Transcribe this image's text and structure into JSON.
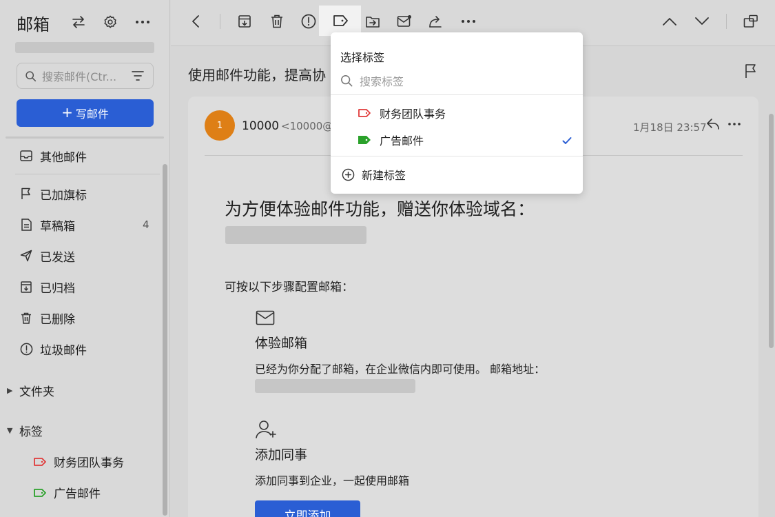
{
  "sidebar": {
    "title": "邮箱",
    "search_placeholder": "搜索邮件(Ctr...",
    "compose_label": "写邮件",
    "items": [
      {
        "label": "其他邮件"
      },
      {
        "label": "已加旗标"
      },
      {
        "label": "草稿箱",
        "count": "4"
      },
      {
        "label": "已发送"
      },
      {
        "label": "已归档"
      },
      {
        "label": "已删除"
      },
      {
        "label": "垃圾邮件"
      }
    ],
    "folders_label": "文件夹",
    "tags_label": "标签",
    "tags": [
      {
        "label": "财务团队事务",
        "color": "#e03a3a"
      },
      {
        "label": "广告邮件",
        "color": "#2aa12a"
      }
    ]
  },
  "toolbar": {
    "icons": [
      "back-icon",
      "archive-icon",
      "delete-icon",
      "spam-icon",
      "tag-icon",
      "move-icon",
      "mark-unread-icon",
      "forward-icon",
      "more-icon",
      "previous-icon",
      "next-icon",
      "new-window-icon"
    ]
  },
  "message": {
    "subject": "使用邮件功能，提高协",
    "avatar_text": "1",
    "sender_name": "10000",
    "sender_address": "<10000@e",
    "date": "1月18日 23:57",
    "headline": "为方便体验邮件功能，赠送你体验域名：",
    "steps_intro": "可按以下步骤配置邮箱：",
    "section1_title": "体验邮箱",
    "section1_text": "已经为你分配了邮箱，在企业微信内即可使用。 邮箱地址：",
    "section2_title": "添加同事",
    "section2_text": "添加同事到企业，一起使用邮箱",
    "add_button": "立即添加"
  },
  "tag_dropdown": {
    "title": "选择标签",
    "search_placeholder": "搜索标签",
    "tags": [
      {
        "label": "财务团队事务",
        "color": "#e03a3a",
        "checked": false
      },
      {
        "label": "广告邮件",
        "color": "#2aa12a",
        "checked": true
      }
    ],
    "new_tag_label": "新建标签"
  },
  "colors": {
    "accent": "#2a5ed4",
    "avatar": "#de7f16",
    "check": "#2a5ed4"
  }
}
